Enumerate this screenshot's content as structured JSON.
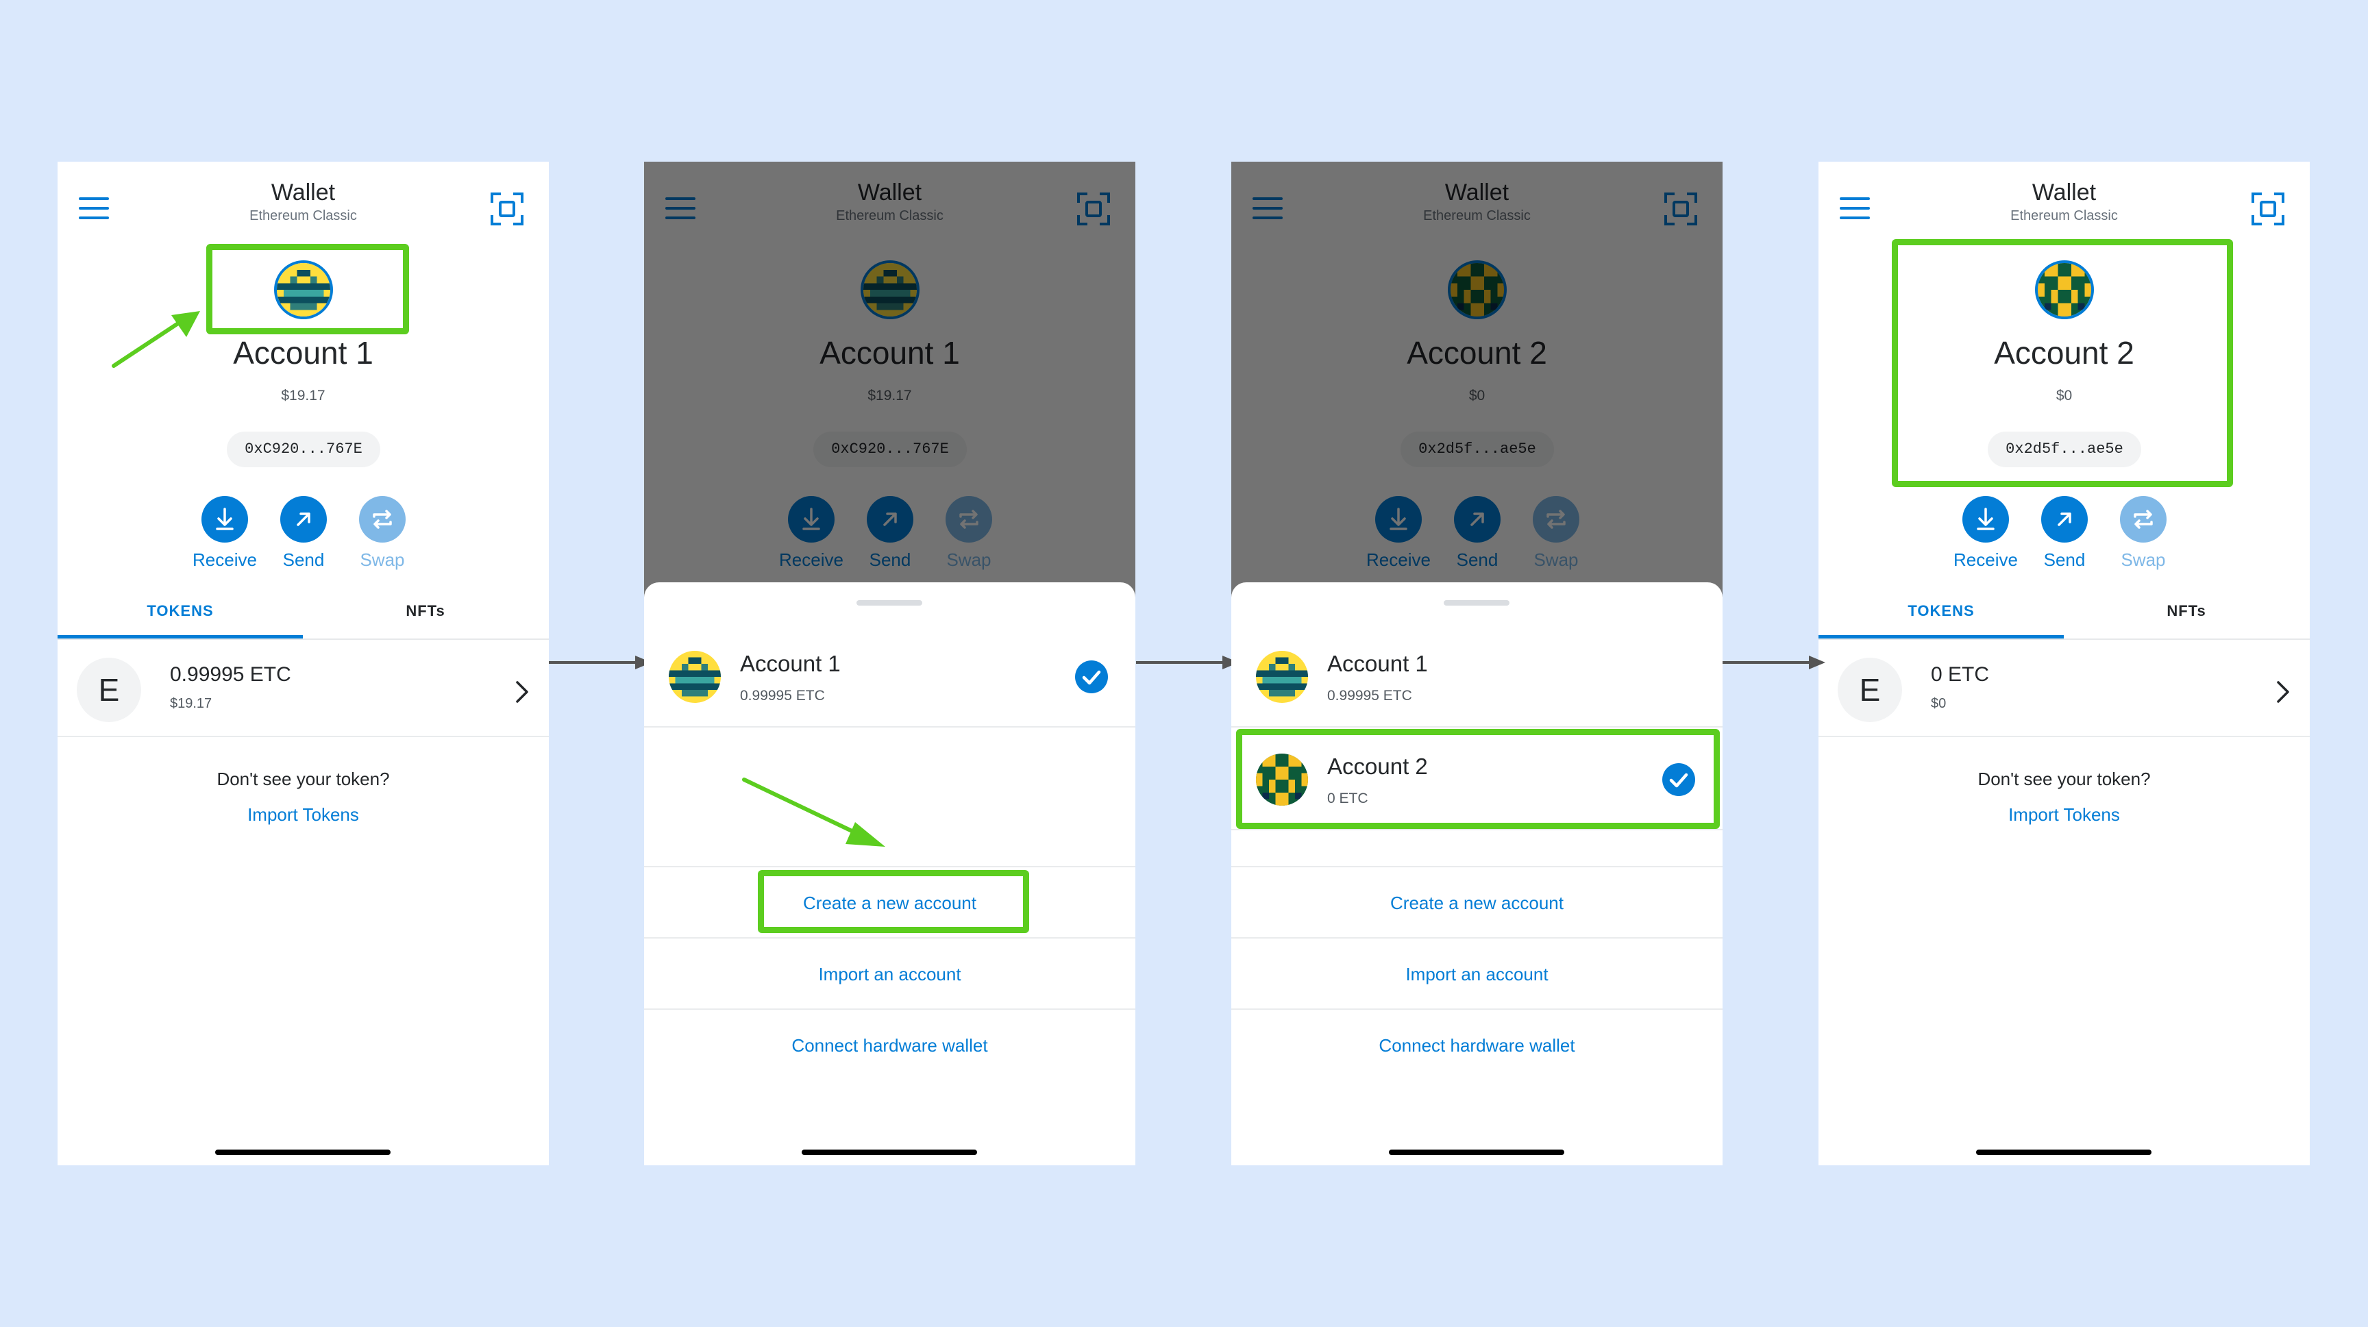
{
  "colors": {
    "background": "#dae8fc",
    "accent": "#037dd6",
    "highlight": "#5ccd1f",
    "text": "#24272a"
  },
  "header": {
    "title": "Wallet",
    "network": "Ethereum Classic"
  },
  "actions": {
    "receive": "Receive",
    "send": "Send",
    "swap": "Swap"
  },
  "tabs": {
    "tokens": "TOKENS",
    "nfts": "NFTs"
  },
  "empty": {
    "message": "Don't see your token?",
    "import_link": "Import Tokens"
  },
  "sheet_links": {
    "create": "Create a new account",
    "import": "Import an account",
    "hardware": "Connect hardware wallet"
  },
  "accounts": [
    {
      "name": "Account 1",
      "balance_fiat": "$19.17",
      "address_short": "0xC920...767E",
      "token_amount": "0.99995 ETC",
      "sheet_balance": "0.99995 ETC"
    },
    {
      "name": "Account 2",
      "balance_fiat": "$0",
      "address_short": "0x2d5f...ae5e",
      "token_amount": "0 ETC",
      "sheet_balance": "0 ETC"
    }
  ],
  "token_icon_letter": "E",
  "screens": [
    {
      "step": 1,
      "active_account": "Account 1",
      "highlight": "avatar"
    },
    {
      "step": 2,
      "active_account": "Account 1",
      "sheet_open": true,
      "highlight": "create-new-account"
    },
    {
      "step": 3,
      "active_account": "Account 2",
      "sheet_open": true,
      "highlight": "account-2-row"
    },
    {
      "step": 4,
      "active_account": "Account 2",
      "highlight": "account-card"
    }
  ]
}
